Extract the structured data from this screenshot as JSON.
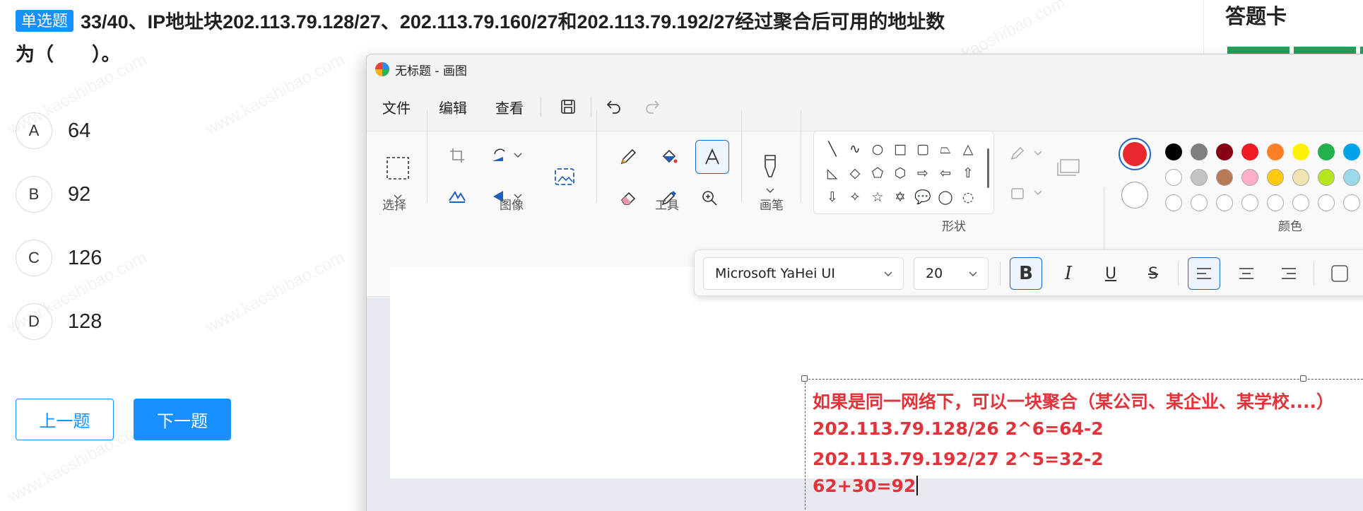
{
  "quiz": {
    "type_badge": "单选题",
    "question_line1": "33/40、IP地址块202.113.79.128/27、202.113.79.160/27和202.113.79.192/27经过聚合后可用的地址数",
    "question_line2": "为（　　）。",
    "options": [
      {
        "letter": "A",
        "text": "64"
      },
      {
        "letter": "B",
        "text": "92"
      },
      {
        "letter": "C",
        "text": "126"
      },
      {
        "letter": "D",
        "text": "128"
      }
    ],
    "prev_label": "上一题",
    "next_label": "下一题"
  },
  "answer_card": {
    "title": "答题卡"
  },
  "watermark_text": "www.kaoshibao.com",
  "paint": {
    "title": "无标题 - 画图",
    "menu": [
      "文件",
      "编辑",
      "查看"
    ],
    "groups": {
      "select": "选择",
      "image": "图像",
      "tools": "工具",
      "brush": "画笔",
      "shapes": "形状",
      "colors": "颜色"
    },
    "shape_glyphs": [
      "╲",
      "∿",
      "○",
      "□",
      "▢",
      "⏢",
      "△",
      "◺",
      "◇",
      "⬠",
      "⬡",
      "⇨",
      "⇦",
      "⇧",
      "⇩",
      "✧",
      "☆",
      "✡",
      "💬",
      "◯",
      "◌"
    ],
    "colors": {
      "primary": "#e8282e",
      "secondary": "#ffffff",
      "palette_row1": [
        "#000000",
        "#7f7f7f",
        "#880015",
        "#ed1c24",
        "#ff7f27",
        "#fff200",
        "#22b14c",
        "#00a2e8"
      ],
      "palette_row2": [
        "#ffffff",
        "#c3c3c3",
        "#b97a57",
        "#ffaec9",
        "#ffc90e",
        "#efe4b0",
        "#b5e61d",
        "#99d9ea"
      ],
      "palette_row3": [
        "#ffffff",
        "#ffffff",
        "#ffffff",
        "#ffffff",
        "#ffffff",
        "#ffffff",
        "#ffffff",
        "#ffffff"
      ]
    },
    "text_toolbar": {
      "font": "Microsoft YaHei UI",
      "size": "20",
      "bold": "B",
      "italic": "I",
      "underline": "U",
      "strike": "S"
    },
    "canvas_text": [
      "如果是同一网络下，可以一块聚合（某公司、某企业、某学校....）",
      "202.113.79.128/26   2^6=64-2",
      "202.113.79.192/27   2^5=32-2",
      "62+30=92"
    ]
  }
}
